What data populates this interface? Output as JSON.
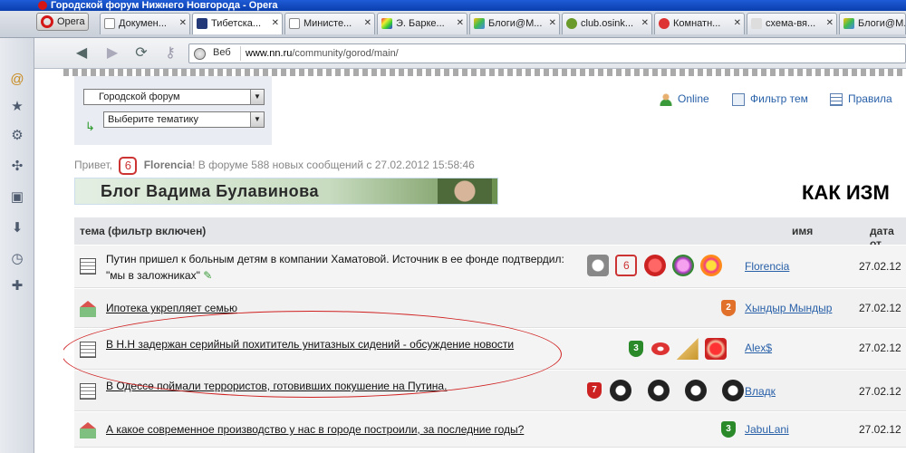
{
  "window": {
    "title": "Городской форум Нижнего Новгорода - Opera"
  },
  "opera_button": "Opera",
  "tabs": [
    {
      "label": "Докумен...",
      "active": false
    },
    {
      "label": "Тибетска...",
      "active": true
    },
    {
      "label": "Министе...",
      "active": false
    },
    {
      "label": "Э. Барке...",
      "active": false
    },
    {
      "label": "Блоги@М...",
      "active": false
    },
    {
      "label": "club.osink...",
      "active": false
    },
    {
      "label": "Комнатн...",
      "active": false
    },
    {
      "label": "схема-вя...",
      "active": false
    },
    {
      "label": "Блоги@М...",
      "active": false
    }
  ],
  "address": {
    "mode_label": "Веб",
    "url_host": "www.nn.ru",
    "url_path": "/community/gorod/main/"
  },
  "forum": {
    "section_select": "Городской форум",
    "topic_select": "Выберите тематику",
    "links": {
      "online": "Online",
      "filter": "Фильтр тем",
      "rules": "Правила"
    },
    "greeting": {
      "hello": "Привет,",
      "badge": "6",
      "nick": "Florencia",
      "rest": "! В форуме 588 новых сообщений с 27.02.2012 15:58:46"
    },
    "banner_text": "Блог Вадима Булавинова",
    "headline": "КАК ИЗМ"
  },
  "table": {
    "headers": {
      "topic": "тема (фильтр включен)",
      "name": "имя",
      "date": "дата от"
    },
    "rows": [
      {
        "title_line1": "Путин пришел к больным детям в компании Хаматовой. Источник в ее фонде подтвердил:",
        "title_line2": "\"мы в заложниках\"",
        "author": "Florencia",
        "date": "27.02.12",
        "icon": "doc-icon"
      },
      {
        "title_line1": "Ипотека укрепляет семью",
        "title_line2": "",
        "author": "Хындыр Мындыр",
        "author_badge": "2",
        "date": "27.02.12",
        "icon": "house-icon"
      },
      {
        "title_line1": "В Н.Н задержан серийный похититель унитазных сидений - обсуждение новости",
        "title_line2": "",
        "author": "Alex$",
        "author_badge": "",
        "date": "27.02.12",
        "icon": "doc-icon"
      },
      {
        "title_line1": "В Одессе поймали террористов, готовивших покушение на Путина.",
        "title_line2": "",
        "author": "Владк",
        "author_badge": "",
        "date": "27.02.12",
        "icon": "doc-icon"
      },
      {
        "title_line1": "А какое современное производство у нас в городе построили, за последние годы?",
        "title_line2": "",
        "author": "JabuLani",
        "author_badge": "3",
        "date": "27.02.12",
        "icon": "house-icon"
      }
    ]
  },
  "badges": {
    "b6": "6",
    "b3": "3",
    "b7": "7"
  },
  "colors": {
    "link": "#2860a8",
    "title_bar": "#0a3fae",
    "annotation_oval": "#d02020"
  }
}
